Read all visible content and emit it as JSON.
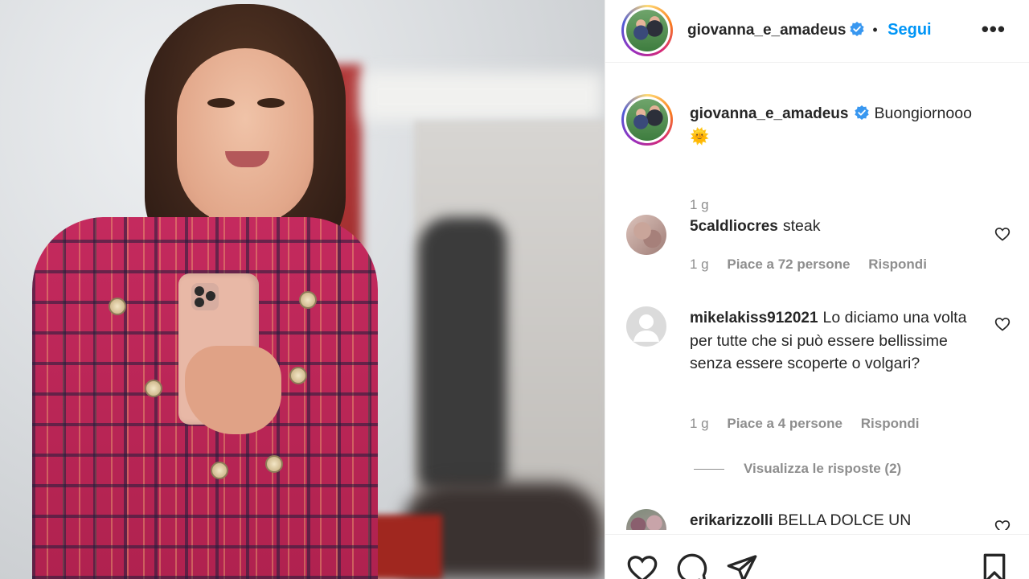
{
  "header": {
    "username": "giovanna_e_amadeus",
    "separator": "•",
    "follow_label": "Segui",
    "more_label": "•••"
  },
  "caption": {
    "username": "giovanna_e_amadeus",
    "text": "Buongiornooo",
    "emoji": "🌞",
    "time": "1 g"
  },
  "comments": [
    {
      "username": "5caldliocres",
      "text": "steak",
      "time": "1 g",
      "likes": "Piace a 72 persone",
      "reply_label": "Rispondi"
    },
    {
      "username": "mikelakiss912021",
      "text": "Lo diciamo una volta per tutte che si può essere bellissime senza essere scoperte o volgari?",
      "time": "1 g",
      "likes": "Piace a 4 persone",
      "reply_label": "Rispondi",
      "view_replies": "Visualizza le risposte (2)"
    },
    {
      "username": "erikarizzolli",
      "text": "BELLA DOLCE UN"
    }
  ],
  "colors": {
    "accent": "#0095f6",
    "text": "#262626",
    "muted": "#8e8e8e",
    "verified": "#3897f0"
  },
  "icons": {
    "like": "heart-icon",
    "comment": "comment-icon",
    "share": "paper-plane-icon",
    "save": "bookmark-icon",
    "verified": "verified-badge-icon",
    "more": "more-options-icon"
  }
}
